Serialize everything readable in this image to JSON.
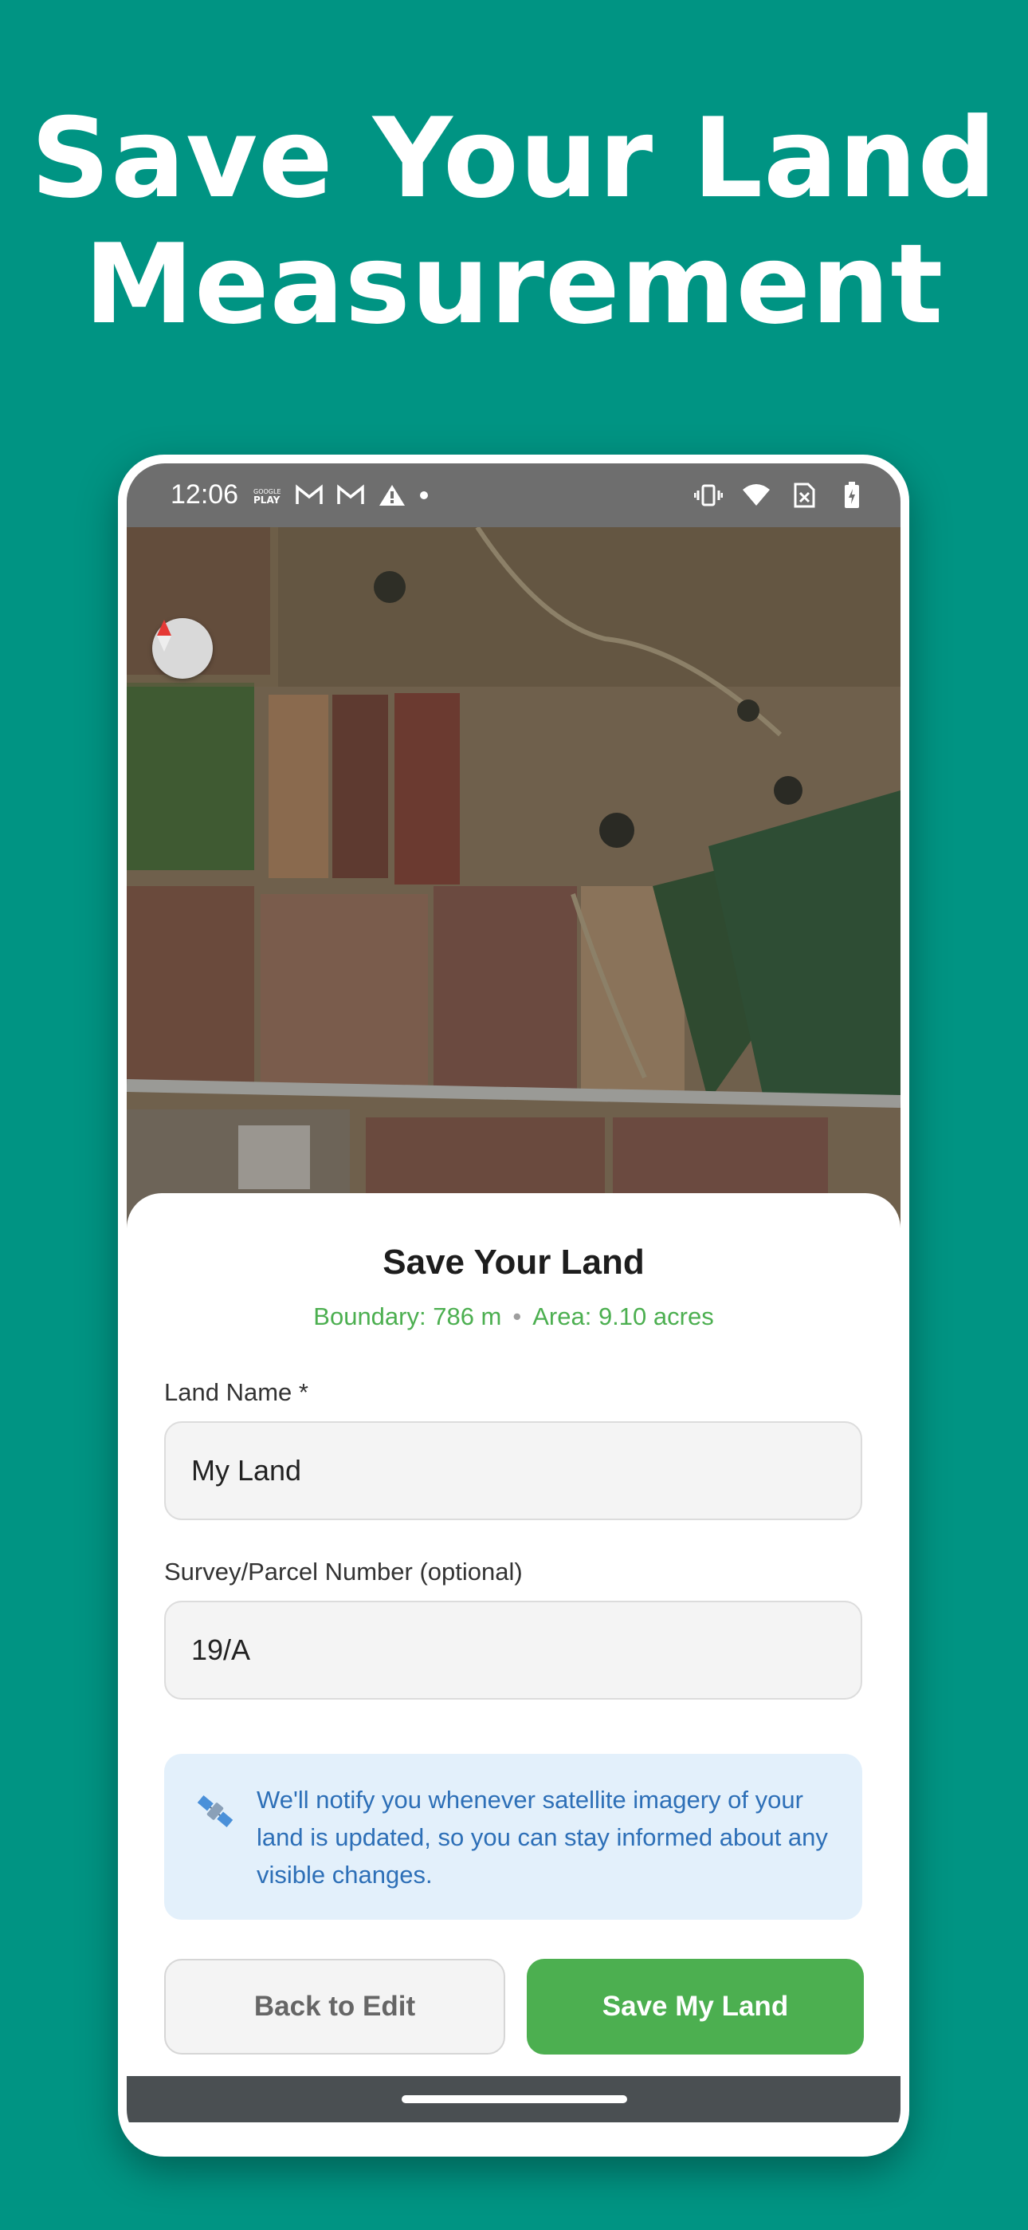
{
  "headline": {
    "line1": "Save Your Land",
    "line2": "Measurement"
  },
  "status_bar": {
    "time": "12:06",
    "left_icons": [
      "google-play-icon",
      "gmail-icon",
      "gmail-icon",
      "alert-icon",
      "dot-icon"
    ],
    "right_icons": [
      "vibrate-icon",
      "wifi-icon",
      "no-sim-icon",
      "battery-icon"
    ]
  },
  "map": {
    "compass_icon": "compass-icon"
  },
  "sheet": {
    "title": "Save Your Land",
    "boundary": "Boundary: 786 m",
    "separator": "•",
    "area": "Area: 9.10 acres"
  },
  "form": {
    "land_name_label": "Land Name *",
    "land_name_value": "My Land",
    "survey_label": "Survey/Parcel Number (optional)",
    "survey_value": "19/A"
  },
  "info": {
    "icon": "satellite-icon",
    "text": "We'll notify you whenever satellite imagery of your land is updated, so you can stay informed about any visible changes."
  },
  "buttons": {
    "back": "Back to Edit",
    "save": "Save My Land"
  },
  "colors": {
    "background": "#009483",
    "accent_green": "#4caf50",
    "info_bg": "#e3f0fb",
    "info_text": "#2d6fb7"
  }
}
